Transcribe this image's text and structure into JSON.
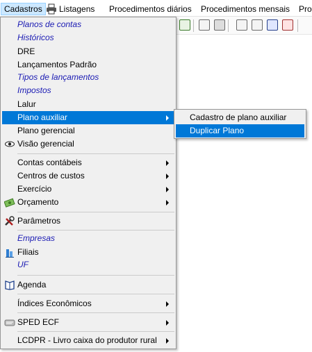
{
  "menubar": {
    "items": [
      "Cadastros",
      "Listagens",
      "Procedimentos diários",
      "Procedimentos mensais",
      "Proc"
    ]
  },
  "toolbar": {
    "icons": [
      "table-icon",
      "chat-icon",
      "calculator-icon",
      "document-icon",
      "pen-icon",
      "book-icon",
      "tools-icon"
    ]
  },
  "cadastros_menu": {
    "items": [
      {
        "label": "Planos de contas",
        "style": "italic"
      },
      {
        "label": "Históricos",
        "style": "italic"
      },
      {
        "label": "DRE"
      },
      {
        "label": "Lançamentos Padrão"
      },
      {
        "label": "Tipos de lançamentos",
        "style": "italic"
      },
      {
        "label": "Impostos",
        "style": "italic"
      },
      {
        "label": "Lalur"
      },
      {
        "label": "Plano auxiliar",
        "submenu": true,
        "highlighted": true
      },
      {
        "label": "Plano gerencial"
      },
      {
        "label": "Visão gerencial",
        "icon": "eye-icon"
      },
      {
        "label": "Contas contábeis",
        "submenu": true
      },
      {
        "label": "Centros de custos",
        "submenu": true
      },
      {
        "label": "Exercício",
        "submenu": true
      },
      {
        "label": "Orçamento",
        "submenu": true,
        "icon": "money-icon"
      },
      {
        "label": "Parâmetros",
        "icon": "tools-icon"
      },
      {
        "label": "Empresas",
        "style": "italic"
      },
      {
        "label": "Filiais",
        "icon": "building-icon"
      },
      {
        "label": "UF",
        "style": "italic"
      },
      {
        "label": "Agenda",
        "icon": "book-icon"
      },
      {
        "label": "Índices Econômicos",
        "submenu": true
      },
      {
        "label": "SPED ECF",
        "submenu": true,
        "icon": "sped-icon"
      },
      {
        "label": "LCDPR - Livro caixa do produtor rural",
        "submenu": true
      }
    ]
  },
  "plano_auxiliar_submenu": {
    "items": [
      {
        "label": "Cadastro de plano auxiliar"
      },
      {
        "label": "Duplicar Plano",
        "highlighted": true
      }
    ]
  },
  "colors": {
    "highlight": "#0078d7",
    "italic_text": "#1a1ab3",
    "menu_bg": "#f0f0f0"
  }
}
